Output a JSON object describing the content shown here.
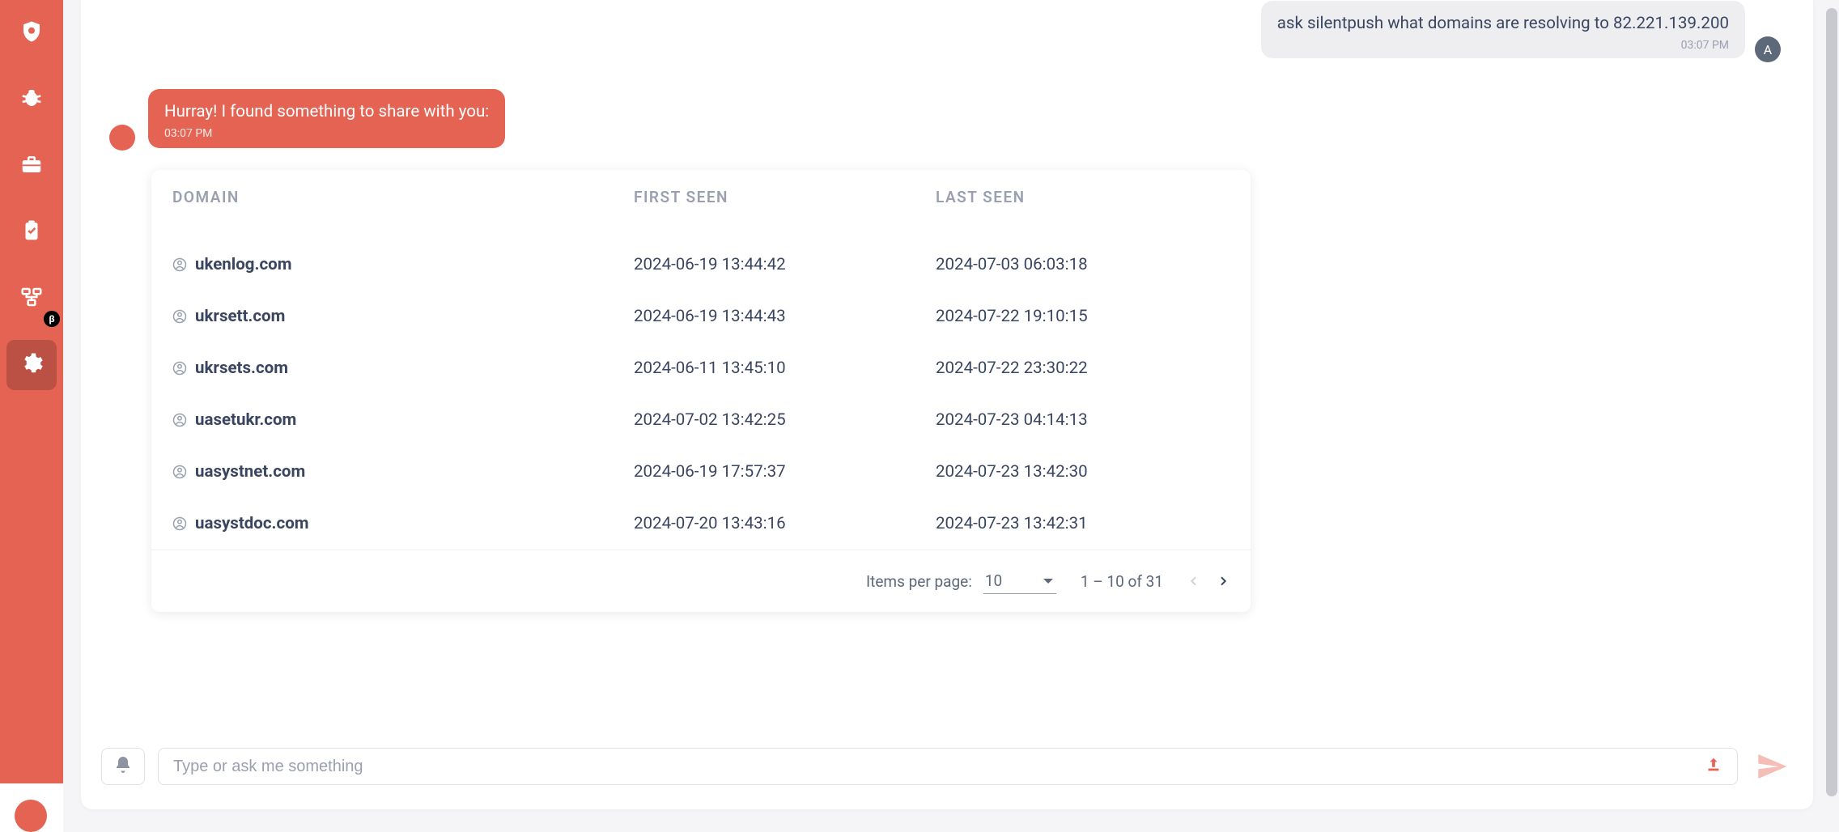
{
  "sidebar": {
    "items": [
      {
        "name": "shield-icon"
      },
      {
        "name": "bug-icon"
      },
      {
        "name": "briefcase-icon"
      },
      {
        "name": "clipboard-icon"
      },
      {
        "name": "workflow-icon",
        "badge": "β"
      },
      {
        "name": "gear-icon",
        "active": true
      }
    ]
  },
  "chat": {
    "user_message": {
      "text": "ask silentpush what domains are resolving to 82.221.139.200",
      "time": "03:07 PM",
      "avatar_letter": "A"
    },
    "bot_message": {
      "text": "Hurray! I found something to share with you:",
      "time": "03:07 PM"
    }
  },
  "table": {
    "headers": {
      "domain": "DOMAIN",
      "first_seen": "FIRST SEEN",
      "last_seen": "LAST SEEN"
    },
    "rows": [
      {
        "domain": "ukenlog.com",
        "first_seen": "2024-06-19 13:44:42",
        "last_seen": "2024-07-03 06:03:18"
      },
      {
        "domain": "ukrsett.com",
        "first_seen": "2024-06-19 13:44:43",
        "last_seen": "2024-07-22 19:10:15"
      },
      {
        "domain": "ukrsets.com",
        "first_seen": "2024-06-11 13:45:10",
        "last_seen": "2024-07-22 23:30:22"
      },
      {
        "domain": "uasetukr.com",
        "first_seen": "2024-07-02 13:42:25",
        "last_seen": "2024-07-23 04:14:13"
      },
      {
        "domain": "uasystnet.com",
        "first_seen": "2024-06-19 17:57:37",
        "last_seen": "2024-07-23 13:42:30"
      },
      {
        "domain": "uasystdoc.com",
        "first_seen": "2024-07-20 13:43:16",
        "last_seen": "2024-07-23 13:42:31"
      }
    ]
  },
  "pagination": {
    "items_per_page_label": "Items per page:",
    "items_per_page_value": "10",
    "range_text": "1 – 10 of 31"
  },
  "input": {
    "placeholder": "Type or ask me something"
  },
  "colors": {
    "accent": "#e56353",
    "text_dark": "#3a4560",
    "text_muted": "#9aa0af"
  }
}
